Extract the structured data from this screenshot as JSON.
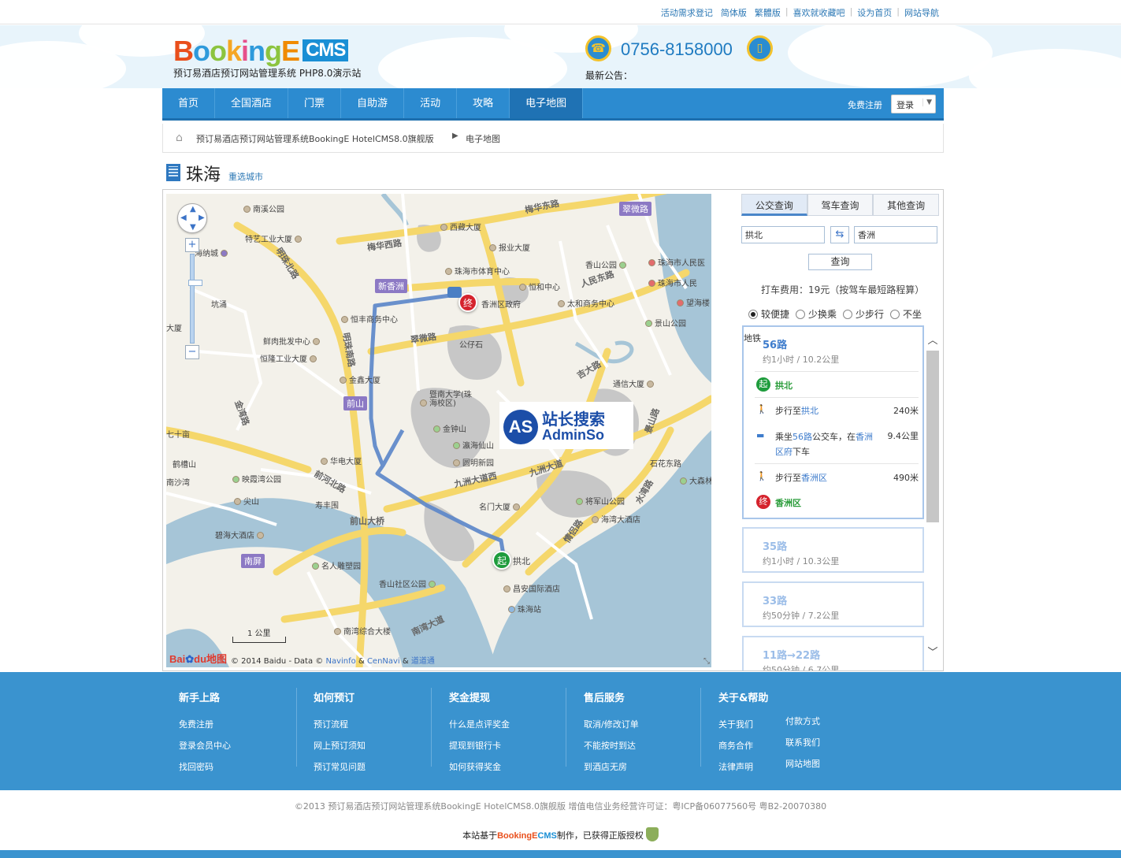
{
  "topbar": {
    "links": [
      "活动需求登记",
      "简体版",
      "繁體版",
      "喜欢就收藏吧",
      "设为首页",
      "网站导航"
    ]
  },
  "header": {
    "logo_text": "BookingE",
    "logo_cms": "CMS",
    "slogan": "预订易酒店预订网站管理系统 PHP8.0演示站",
    "phone": "0756-8158000",
    "notice_label": "最新公告："
  },
  "nav": {
    "items": [
      "首页",
      "全国酒店",
      "门票",
      "自助游",
      "活动",
      "攻略",
      "电子地图"
    ],
    "active": "电子地图",
    "register": "免费注册",
    "login": "登录"
  },
  "breadcrumb": {
    "site": "预订易酒店预订网站管理系统BookingE HotelCMS8.0旗舰版",
    "current": "电子地图"
  },
  "city": {
    "name": "珠海",
    "reselect": "重选城市"
  },
  "map": {
    "pois": [
      "南溪公园",
      "特艺工业大厦",
      "海纳城",
      "坑涌",
      "大厦",
      "鲜肉批发中心",
      "恒隆工业大厦",
      "西藏大厦",
      "报业大厦",
      "珠海市体育中心",
      "恒和中心",
      "香山公园",
      "珠海市人民医",
      "珠海市人民",
      "香洲区政府",
      "太和商务中心",
      "恒丰商务中心",
      "望海楼",
      "景山公园",
      "公仔石",
      "金鑫大厦",
      "暨南大学(珠海校区)",
      "通信大厦",
      "金钟山",
      "瀛海仙山",
      "圆明新园",
      "华电大厦",
      "映霞湾公园",
      "尖山",
      "寿丰围",
      "名门大厦",
      "将军山公园",
      "海湾大酒店",
      "石花东路",
      "大森林",
      "碧海大酒店",
      "名人雕塑园",
      "香山社区公园",
      "昌安国际酒店",
      "珠海站",
      "南湾综合大楼",
      "南沙湾",
      "鹤槽山",
      "七十亩"
    ],
    "roads": [
      "梅华西路",
      "梅华东路",
      "翠微路",
      "明珠北路",
      "明珠南路",
      "前山",
      "九洲大道西",
      "九洲大道",
      "人民东路",
      "吉大路",
      "景山路",
      "前山大桥",
      "前山路",
      "金湾路",
      "前河北路",
      "南湾大道",
      "情侣路",
      "珠海大道",
      "水湾路"
    ],
    "badges": [
      "新香洲",
      "翠微路",
      "前山",
      "南屏"
    ],
    "start_label": "起",
    "start_poi": "拱北",
    "end_label": "终",
    "scale": "1 公里",
    "brand_bai": "Bai",
    "brand_du": "du",
    "brand_map": "地图",
    "copyright": "© 2014 Baidu - Data ©",
    "copyright_links": [
      "Navinfo",
      "CenNavi",
      "道道通"
    ],
    "copyright_amp": "&",
    "watermark_logo": "AS",
    "watermark_cn": "站长搜索",
    "watermark_en": "AdminSo"
  },
  "search": {
    "tabs": [
      "公交查询",
      "驾车查询",
      "其他查询"
    ],
    "active_tab": "公交查询",
    "from": "拱北",
    "to": "香洲",
    "button": "查询",
    "fare": "打车费用：19元（按驾车最短路程算）",
    "options": [
      "较便捷",
      "少换乘",
      "少步行",
      "不坐"
    ],
    "selected_option": "较便捷",
    "subway_tag": "地铁"
  },
  "results": [
    {
      "route": "56路",
      "summary": "约1小时 / 10.2公里",
      "steps": [
        {
          "type": "start",
          "icon": "起",
          "text": "拱北"
        },
        {
          "type": "walk",
          "text_prefix": "步行至",
          "place": "拱北",
          "dist": "240米"
        },
        {
          "type": "bus",
          "text_prefix": "乘坐",
          "route": "56路",
          "text_mid": "公交车，在",
          "place": "香洲区府",
          "text_suffix": "下车",
          "dist": "9.4公里"
        },
        {
          "type": "walk",
          "text_prefix": "步行至",
          "place": "香洲区",
          "dist": "490米"
        },
        {
          "type": "end",
          "icon": "终",
          "text": "香洲区"
        }
      ]
    },
    {
      "route": "35路",
      "summary": "约1小时 / 10.3公里"
    },
    {
      "route": "33路",
      "summary": "约50分钟 / 7.2公里"
    },
    {
      "route": "11路→22路",
      "summary": "约50分钟 / 6.7公里"
    }
  ],
  "footer": {
    "cols": [
      {
        "title": "新手上路",
        "links": [
          "免费注册",
          "登录会员中心",
          "找回密码"
        ]
      },
      {
        "title": "如何预订",
        "links": [
          "预订流程",
          "网上预订须知",
          "预订常见问题"
        ]
      },
      {
        "title": "奖金提现",
        "links": [
          "什么是点评奖金",
          "提现到银行卡",
          "如何获得奖金"
        ]
      },
      {
        "title": "售后服务",
        "links": [
          "取消/修改订单",
          "不能按时到达",
          "到酒店无房"
        ]
      },
      {
        "title": "关于&帮助",
        "links": [
          "关于我们",
          "商务合作",
          "法律声明"
        ],
        "links2": [
          "付款方式",
          "联系我们",
          "网站地图"
        ]
      }
    ],
    "copyright": "©2013 预订易酒店预订网站管理系统BookingE HotelCMS8.0旗舰版  增值电信业务经营许可证：粤ICP备06077560号  粤B2-20070380",
    "powered_prefix": "本站基于",
    "powered_logo": "BookingE",
    "powered_logo_cms": "CMS",
    "powered_suffix": "制作，已获得正版授权"
  },
  "colors": {
    "nav_blue": "#2c8bd0",
    "link_blue": "#2c78b5",
    "route_blue": "#4a7fc4",
    "start_green": "#1e9c3c",
    "end_red": "#d5232d"
  }
}
